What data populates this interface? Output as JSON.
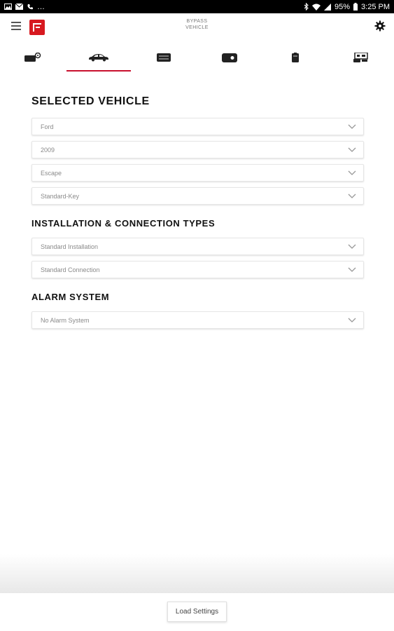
{
  "status_bar": {
    "battery": "95%",
    "time": "3:25 PM",
    "left_icons": [
      "image-icon",
      "mail-icon",
      "phone-icon",
      "more-icon"
    ],
    "right_icons": [
      "bluetooth-icon",
      "wifi-icon",
      "signal-icon",
      "battery-icon"
    ]
  },
  "app_bar": {
    "title_line1": "BYPASS",
    "title_line2": "VEHICLE",
    "brand_color": "#d71920"
  },
  "tabs": [
    {
      "icon": "module-icon",
      "active": false
    },
    {
      "icon": "car-icon",
      "active": true
    },
    {
      "icon": "controller-icon",
      "active": false
    },
    {
      "icon": "remote-icon",
      "active": false
    },
    {
      "icon": "device-icon",
      "active": false
    },
    {
      "icon": "accessory-icon",
      "active": false
    }
  ],
  "accent_color": "#c8102e",
  "sections": {
    "selected_vehicle": {
      "title": "SELECTED VEHICLE",
      "fields": [
        "Ford",
        "2009",
        "Escape",
        "Standard-Key"
      ]
    },
    "installation": {
      "title": "INSTALLATION & CONNECTION TYPES",
      "fields": [
        "Standard Installation",
        "Standard Connection"
      ]
    },
    "alarm": {
      "title": "ALARM SYSTEM",
      "fields": [
        "No Alarm System"
      ]
    }
  },
  "footer": {
    "load_label": "Load Settings"
  }
}
